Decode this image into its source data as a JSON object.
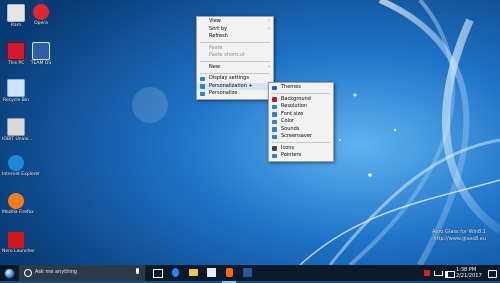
{
  "desktop_icons": [
    {
      "name": "recycle-like-icon",
      "label": "Ram"
    },
    {
      "name": "opera-icon",
      "label": "Opera"
    },
    {
      "name": "this-pc-icon",
      "label": "This PC"
    },
    {
      "name": "team-os-icon",
      "label": "TEAM OS"
    },
    {
      "name": "recycle-bin-icon",
      "label": "Recycle Bin"
    },
    {
      "name": "iobit-icon",
      "label": "IOBIT Unins..."
    },
    {
      "name": "internet-explorer-icon",
      "label": "Internet Explorer"
    },
    {
      "name": "firefox-icon",
      "label": "Mozilla Firefox"
    },
    {
      "name": "nero-icon",
      "label": "Nero Launcher"
    }
  ],
  "context_menu": {
    "items": [
      "View",
      "Sort by",
      "Refresh",
      "Paste",
      "Paste shortcut",
      "New",
      "Display settings",
      "Personalization +",
      "Personalize"
    ]
  },
  "submenu": {
    "items": [
      "Themes",
      "Background",
      "Resolution",
      "Font size",
      "Color",
      "Sounds",
      "Screensaver",
      "Icons",
      "Pointers"
    ]
  },
  "watermark": {
    "line1": "Aero Glass for Win8.1",
    "line2": "http://www.glass8.eu"
  },
  "taskbar": {
    "search_placeholder": "Ask me anything",
    "time": "1:38 PM",
    "date": "2/21/2017"
  },
  "colors": {
    "accent": "#1f73c8",
    "taskbar": "#0b1a2b",
    "menu_bg": "#f2f2f2"
  }
}
